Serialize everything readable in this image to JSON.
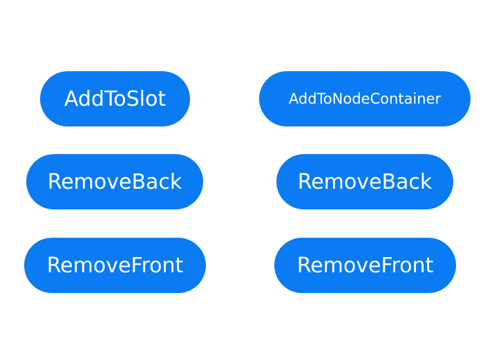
{
  "theme": {
    "background": "#ffffff",
    "button_color": "#0a7bf2",
    "button_text_color": "#ffffff"
  },
  "left_column": {
    "add_label": "AddToSlot",
    "remove_back_label": "RemoveBack",
    "remove_front_label": "RemoveFront"
  },
  "right_column": {
    "add_label": "AddToNodeContainer",
    "remove_back_label": "RemoveBack",
    "remove_front_label": "RemoveFront"
  }
}
